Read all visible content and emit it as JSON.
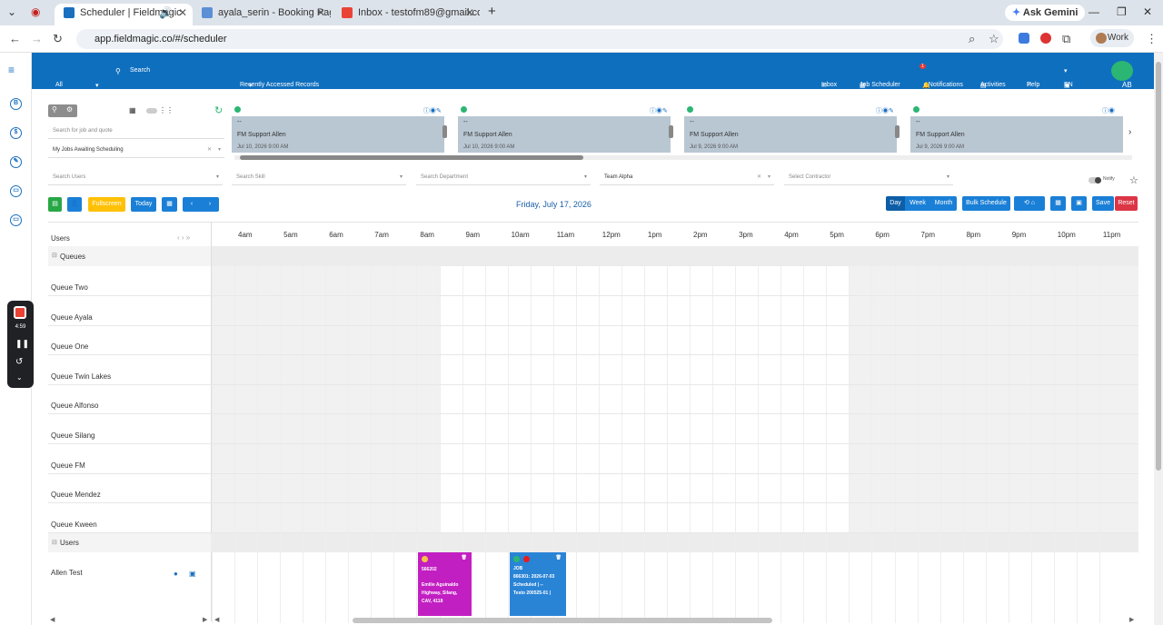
{
  "browser": {
    "tabs": [
      {
        "title": "Scheduler | Fieldmagic"
      },
      {
        "title": "ayala_serin - Booking Pages | F"
      },
      {
        "title": "Inbox - testofm89@gmail.com"
      }
    ],
    "ask_gemini": "Ask Gemini",
    "url": "app.fieldmagic.co/#/scheduler",
    "profile": "Work"
  },
  "recorder": {
    "time": "4:59"
  },
  "header": {
    "filter_all": "All",
    "search": "Search",
    "recent": "Recently Accessed Records",
    "inbox": "Inbox",
    "job_scheduler": "Job Scheduler",
    "notifications": "Notifications",
    "notif_count": "1",
    "activities": "Activities",
    "help": "Help",
    "lang": "EN",
    "avatar": "AB"
  },
  "left_panel": {
    "search_placeholder": "Search for job and quote",
    "filter": "My Jobs Awaiting Scheduling"
  },
  "cards": [
    {
      "line1": "--",
      "name": "FM Support Allen",
      "date": "Jul 10, 2026 9:00 AM"
    },
    {
      "line1": "--",
      "name": "FM Support Allen",
      "date": "Jul 10, 2026 9:00 AM"
    },
    {
      "line1": "--",
      "name": "FM Support Allen",
      "date": "Jul 9, 2026 9:00 AM"
    },
    {
      "line1": "--",
      "name": "FM Support Allen",
      "date": "Jul 9, 2026 9:00 AM"
    }
  ],
  "filters": {
    "users": "Search Users",
    "skill": "Search Skill",
    "department": "Search Department",
    "team": "Team Alpha",
    "contractor": "Select Contractor",
    "notify": "Notify"
  },
  "toolbar": {
    "fullscreen": "Fullscreen",
    "today": "Today",
    "date": "Friday, July 17, 2026",
    "day": "Day",
    "week": "Week",
    "month": "Month",
    "bulk": "Bulk Schedule",
    "save": "Save",
    "reset": "Reset"
  },
  "timeline": {
    "users_label": "Users",
    "hours": [
      "4am",
      "5am",
      "6am",
      "7am",
      "8am",
      "9am",
      "10am",
      "11am",
      "12pm",
      "1pm",
      "2pm",
      "3pm",
      "4pm",
      "5pm",
      "6pm",
      "7pm",
      "8pm",
      "9pm",
      "10pm",
      "11pm"
    ]
  },
  "groups": {
    "queues": "Queues",
    "users": "Users"
  },
  "queues": [
    "Queue Two",
    "Queue Ayala",
    "Queue One",
    "Queue Twin Lakes",
    "Queue Alfonso",
    "Queue Silang",
    "Queue FM",
    "Queue Mendez",
    "Queue Kween"
  ],
  "users": [
    "Allen Test"
  ],
  "jobs": [
    {
      "number": "566202",
      "address": "Emilie Aguinaldo Highway, Silang, CAV, 4118",
      "color": "#c21fc2"
    },
    {
      "type": "JOB",
      "number": "866301: 2026-07-03",
      "status": "Scheduled | --",
      "customer": "Testo 200525-01 |",
      "color": "#2a84d6"
    }
  ],
  "colors": {
    "primary": "#0f6fbf",
    "success": "#28a745",
    "warning": "#ffc107",
    "danger": "#dc3545",
    "info": "#17a2b8"
  }
}
